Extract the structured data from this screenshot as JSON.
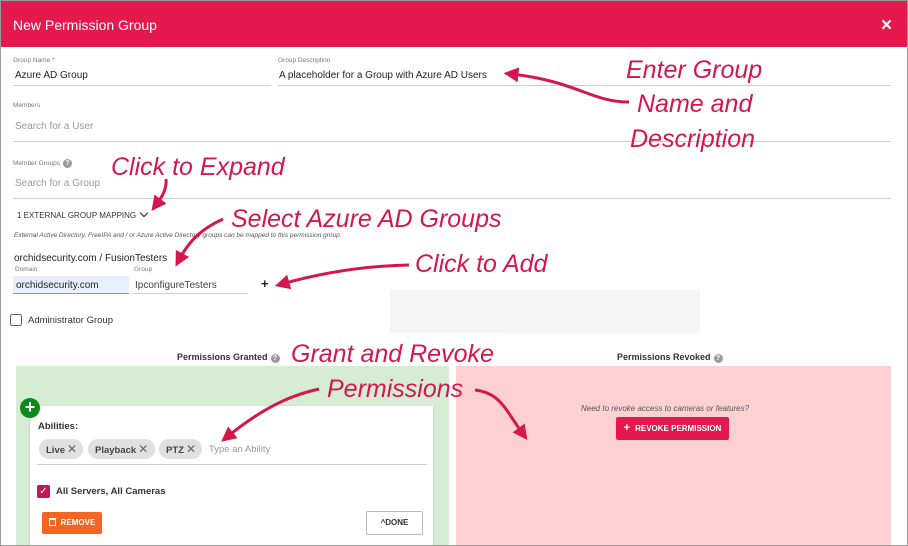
{
  "dialog": {
    "title": "New Permission Group",
    "close_icon": "×"
  },
  "form": {
    "group_name_label": "Group Name *",
    "group_name_value": "Azure AD Group",
    "group_description_label": "Group Description",
    "group_description_value": "A placeholder for a Group with Azure AD Users",
    "members_label": "Members",
    "members_placeholder": "Search for a User",
    "member_groups_label": "Member Groups",
    "member_groups_placeholder": "Search for a Group",
    "external_mapping_toggle": "1 EXTERNAL GROUP MAPPING",
    "external_mapping_help": "External Active Directory, FreeIPA and / or Azure Active Directory groups can be mapped to this permission group.",
    "existing_mapping": "orchidsecurity.com / FusionTesters",
    "domain_label": "Domain",
    "domain_value": "orchidsecurity.com",
    "group_label": "Group",
    "group_value": "IpconfigureTesters",
    "add_symbol": "+",
    "administrator_label": "Administrator Group"
  },
  "permissions": {
    "granted_title": "Permissions Granted",
    "revoked_title": "Permissions Revoked",
    "abilities_label": "Abilities:",
    "abilities": [
      "Live",
      "Playback",
      "PTZ"
    ],
    "ability_placeholder": "Type an Ability",
    "scope_label": "All Servers, All Cameras",
    "remove_label": "REMOVE",
    "done_label": "DONE",
    "revoke_prompt": "Need to revoke access to cameras or features?",
    "revoke_button": "REVOKE PERMISSION"
  },
  "annotations": {
    "name_desc_line1": "Enter Group",
    "name_desc_line2": "Name and",
    "name_desc_line3": "Description",
    "expand": "Click to Expand",
    "select_azure": "Select Azure AD Groups",
    "add": "Click to Add",
    "grant_line1": "Grant and Revoke",
    "grant_line2": "Permissions"
  },
  "colors": {
    "header": "#e6194f",
    "annotation": "#d6174e",
    "granted_bg": "#d6ecd3",
    "revoked_bg": "#fdd1d1",
    "remove_button": "#f26522"
  }
}
